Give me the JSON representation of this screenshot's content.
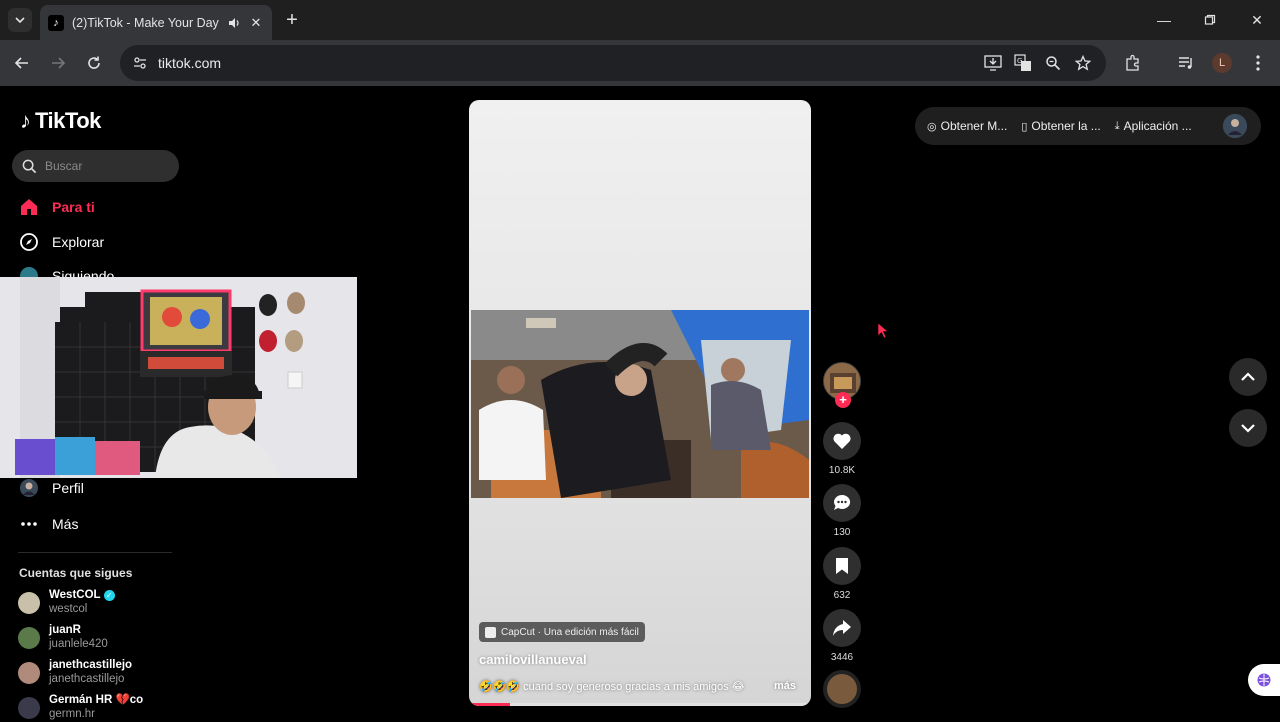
{
  "browser": {
    "tab_title": "(2)TikTok - Make Your Day",
    "url": "tiktok.com",
    "profile_initial": "L"
  },
  "sidebar": {
    "logo": "TikTok",
    "search_placeholder": "Buscar",
    "nav": [
      {
        "label": "Para ti",
        "icon": "home-icon",
        "active": true
      },
      {
        "label": "Explorar",
        "icon": "compass-icon"
      },
      {
        "label": "Siguiendo",
        "icon": "following-icon"
      },
      {
        "label": "Perfil",
        "icon": "profile-icon"
      },
      {
        "label": "Más",
        "icon": "more-icon"
      }
    ],
    "following_title": "Cuentas que sigues",
    "accounts": [
      {
        "name": "WestCOL",
        "handle": "westcol",
        "verified": true
      },
      {
        "name": "juanR",
        "handle": "juanlele420"
      },
      {
        "name": "janethcastillejo",
        "handle": "janethcastillejo"
      },
      {
        "name": "Germán HR 💔co",
        "handle": "germn.hr"
      }
    ]
  },
  "video": {
    "capcut_label": "CapCut · Una edición más fácil",
    "author": "camilovillanueval",
    "description": "🤣🤣🤣 cuand soy generoso gracias a mis amigos 😂",
    "more_label": "más",
    "progress": 0.12
  },
  "actions": {
    "likes": "10.8K",
    "comments": "130",
    "saves": "632",
    "shares": "3446"
  },
  "topbar": {
    "items": [
      "Obtener M...",
      "Obtener la ...",
      "Aplicación ..."
    ]
  },
  "colors": {
    "accent": "#fe2c55",
    "verified": "#20d5ec"
  }
}
